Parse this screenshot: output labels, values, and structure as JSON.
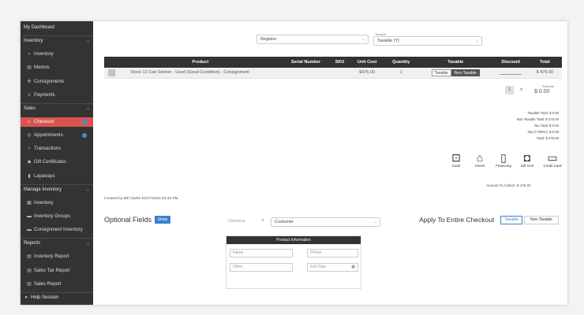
{
  "sidebar": {
    "items": [
      {
        "label": "My Dashboard",
        "icon": "dashboard-icon",
        "glyph": "",
        "kind": "sec"
      },
      {
        "label": "Inventory",
        "icon": "",
        "glyph": "",
        "kind": "sec"
      },
      {
        "label": "Inventory",
        "icon": "cube-icon",
        "glyph": "▪",
        "kind": "item"
      },
      {
        "label": "Memos",
        "icon": "memo-icon",
        "glyph": "▤",
        "kind": "item"
      },
      {
        "label": "Consignments",
        "icon": "handshake-icon",
        "glyph": "✜",
        "kind": "item"
      },
      {
        "label": "Payments",
        "icon": "payments-icon",
        "glyph": "≡",
        "kind": "item"
      },
      {
        "label": "Sales",
        "icon": "",
        "glyph": "",
        "kind": "sec"
      },
      {
        "label": "Checkout",
        "icon": "cart-icon",
        "glyph": "▸",
        "kind": "item",
        "active": true,
        "dot": true
      },
      {
        "label": "Appointments",
        "icon": "calendar-icon",
        "glyph": "◎",
        "kind": "item",
        "dot": true
      },
      {
        "label": "Transactions",
        "icon": "receipt-icon",
        "glyph": "▪",
        "kind": "item"
      },
      {
        "label": "Gift Certificates",
        "icon": "gift-icon",
        "glyph": "◆",
        "kind": "item"
      },
      {
        "label": "Layaways",
        "icon": "layaway-icon",
        "glyph": "▮",
        "kind": "item"
      },
      {
        "label": "Manage Inventory",
        "icon": "",
        "glyph": "",
        "kind": "sec"
      },
      {
        "label": "Inventory",
        "icon": "list-icon",
        "glyph": "▦",
        "kind": "item"
      },
      {
        "label": "Inventory Groups",
        "icon": "folder-icon",
        "glyph": "▬",
        "kind": "item"
      },
      {
        "label": "Consignment Inventory",
        "icon": "folder-icon",
        "glyph": "▬",
        "kind": "item"
      },
      {
        "label": "Reports",
        "icon": "",
        "glyph": "",
        "kind": "sec"
      },
      {
        "label": "Inventory Report",
        "icon": "report-icon",
        "glyph": "▤",
        "kind": "item"
      },
      {
        "label": "Sales Tax Report",
        "icon": "report-icon",
        "glyph": "▤",
        "kind": "item"
      },
      {
        "label": "Sales Report",
        "icon": "report-icon",
        "glyph": "▤",
        "kind": "item"
      },
      {
        "label": "Help Session",
        "icon": "help-icon",
        "glyph": "●",
        "kind": "sec"
      }
    ]
  },
  "top": {
    "location_value": "Register",
    "taxable_small_label": "Taxable",
    "taxable_value": "Taxable (Y)"
  },
  "table": {
    "headers": [
      "",
      "Product",
      "Serial Number",
      "SKU",
      "Unit Cost",
      "Quantity",
      "Taxable",
      "Discount",
      "Total"
    ],
    "row": {
      "product": "Stock 13 Carl Steiner - Used (Good Condition) - Consignment",
      "serial": "",
      "sku": "",
      "unit_cost": "$475.00",
      "quantity": "1",
      "taxable_label": "Taxable",
      "nontaxable_label": "Non-Taxable",
      "discount": "",
      "total": "$ 475.00"
    }
  },
  "pager": {
    "page": "1",
    "next": "»",
    "subtotal_label": "Subtotal",
    "subtotal_value": "$ 0.00"
  },
  "totals": [
    "Taxable Total: $ 0.00",
    "Non-Taxable Total: $ 475.00",
    "Tax Total: $ 0.00",
    "Tax (7.000%): $ 0.00",
    "Total: $ 475.00"
  ],
  "payments": [
    {
      "label": "Cash",
      "icon": "cash-icon",
      "glyph": "⊡"
    },
    {
      "label": "Check",
      "icon": "bank-icon",
      "glyph": "⌂"
    },
    {
      "label": "Financing",
      "icon": "document-icon",
      "glyph": "▯"
    },
    {
      "label": "Gift Cert",
      "icon": "gift-card-icon",
      "glyph": "◘"
    },
    {
      "label": "Credit Card",
      "icon": "credit-card-icon",
      "glyph": "▭"
    }
  ],
  "amount_due": "Amount To Collect: $ 475.00",
  "created_by": "Created by Bill Clarke 01/27/2025 03:32 PM",
  "optional": {
    "title": "Optional Fields",
    "show_label": "Show",
    "for_label": "Checkout",
    "add_symbol": "+",
    "customer_placeholder": "Customer"
  },
  "apply": {
    "label": "Apply To Entire Checkout",
    "taxable": "Taxable",
    "nontaxable": "Non-Taxable"
  },
  "product_info": {
    "title": "Product Information",
    "name_placeholder": "Name",
    "phone_placeholder": "Phone",
    "other_placeholder": "Other",
    "date_placeholder": "Exit Date"
  }
}
